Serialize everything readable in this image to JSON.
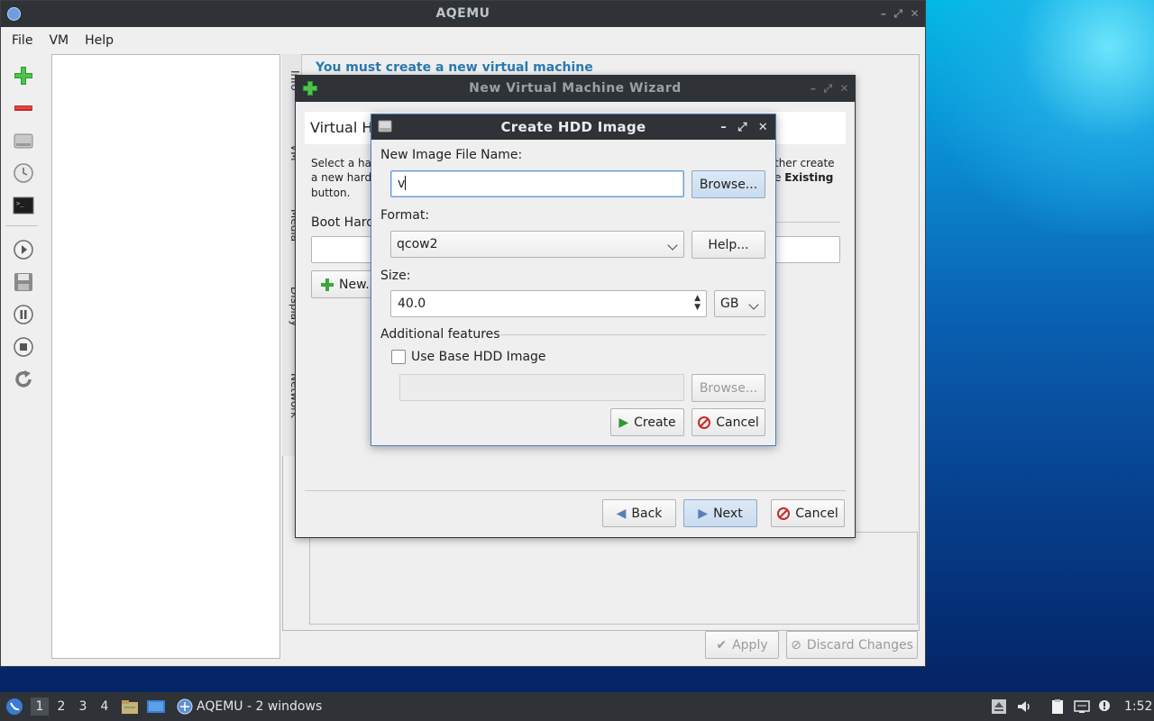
{
  "main_window": {
    "title": "AQEMU",
    "menu": [
      "File",
      "VM",
      "Help"
    ],
    "message": "You must create a new virtual machine",
    "vertical_tabs": [
      "Info",
      "VM",
      "Media",
      "Display",
      "Network"
    ],
    "apply_label": "Apply",
    "discard_label": "Discard Changes"
  },
  "toolbar_icons": [
    "add-vm-icon",
    "remove-vm-icon",
    "hdd-icon",
    "clock-icon",
    "terminal-icon",
    "play-icon",
    "save-icon",
    "pause-icon",
    "stop-icon",
    "reset-icon"
  ],
  "wizard": {
    "title": "New Virtual Machine Wizard",
    "page_title": "Virtual Ha",
    "desc_left_1": "Select a har",
    "desc_left_2": "a new hard",
    "desc_left_3": "button.",
    "desc_right_1": "ther create",
    "desc_right_2a": "e ",
    "desc_right_2b": "Existing",
    "boot_label": "Boot Hard",
    "new_label": "New...",
    "back_label": "Back",
    "next_label": "Next",
    "cancel_label": "Cancel"
  },
  "dialog": {
    "title": "Create HDD Image",
    "file_name_label": "New Image File Name:",
    "file_name_value": "v",
    "browse_label": "Browse...",
    "format_label": "Format:",
    "format_value": "qcow2",
    "help_label": "Help...",
    "size_label": "Size:",
    "size_value": "40.0",
    "size_unit": "GB",
    "additional_label": "Additional features",
    "use_base_label": "Use Base HDD Image",
    "base_browse_label": "Browse...",
    "create_label": "Create",
    "cancel_label": "Cancel"
  },
  "taskbar": {
    "desktops": [
      "1",
      "2",
      "3",
      "4"
    ],
    "task_label": "AQEMU - 2 windows",
    "clock": "1:52"
  }
}
